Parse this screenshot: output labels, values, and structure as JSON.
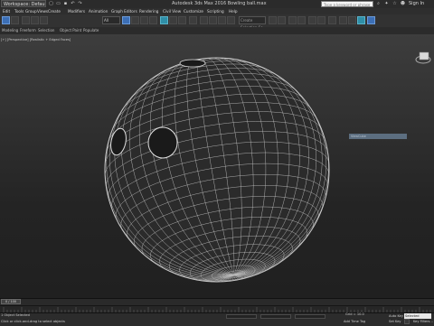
{
  "window": {
    "workspace": "Workspace: Default",
    "title": "Autodesk 3ds Max 2016    Bowling ball.max",
    "search_placeholder": "Type a keyword or phrase",
    "sign_in": "Sign In"
  },
  "menu": [
    "Edit",
    "Tools",
    "Group",
    "Views",
    "Create",
    "Modifiers",
    "Animation",
    "Graph Editors",
    "Rendering",
    "Civil View",
    "Customize",
    "Scripting",
    "Help"
  ],
  "toolbar": {
    "selection_filter": "All",
    "named_selection_placeholder": "Create Selection Se"
  },
  "ribbon": {
    "tabs": [
      "Modeling",
      "Freeform",
      "Selection",
      "Object Paint",
      "Populate"
    ]
  },
  "viewport": {
    "label": "[+] [Perspective] [Realistic + Edged Faces]",
    "tooltip": "ViewCube"
  },
  "timeline": {
    "frame": "0 / 100"
  },
  "status": {
    "selection": "1 Object Selected",
    "prompt": "Click or click-and-drag to select objects",
    "grid": "Grid = 10.0",
    "add_time_tag": "Add Time Tag",
    "auto_key": "Auto Key",
    "set_key": "Set Key",
    "selected": "Selected",
    "key_filters": "Key Filters..."
  },
  "colors": {
    "viewport_top": "#3d3d3d",
    "viewport_bottom": "#202020",
    "wireframe": "#c8c8c8",
    "accent": "#3c6fb6"
  }
}
